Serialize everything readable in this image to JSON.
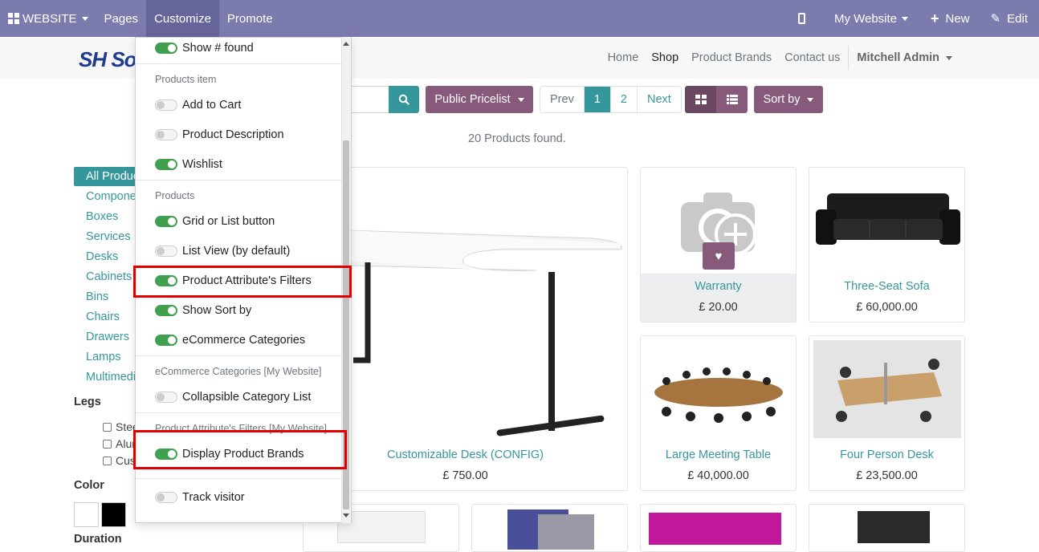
{
  "topbar": {
    "brand": "WEBSITE",
    "menu": [
      "Pages",
      "Customize",
      "Promote"
    ],
    "website_switcher": "My Website",
    "new_label": "New",
    "edit_label": "Edit",
    "bg_color": "#7c7bad"
  },
  "site": {
    "logo_text": "SH So",
    "nav": [
      "Home",
      "Shop",
      "Product Brands",
      "Contact us"
    ],
    "user": "Mitchell Admin"
  },
  "toolbar": {
    "pricelist": "Public Pricelist",
    "pager": [
      "Prev",
      "1",
      "2",
      "Next"
    ],
    "sort_label": "Sort by",
    "found_text": "20 Products found."
  },
  "sidebar": {
    "categories_active": "All Products",
    "categories": [
      "Components",
      "Boxes",
      "Services",
      "Desks",
      "Cabinets",
      "Bins",
      "Chairs",
      "Drawers",
      "Lamps",
      "Multimedia"
    ],
    "legs_heading": "Legs",
    "legs_options": [
      "Steel",
      "Aluminium",
      "Custom"
    ],
    "color_heading": "Color",
    "next_heading": "Duration"
  },
  "products": [
    {
      "name": "Customizable Desk (CONFIG)",
      "price": "£ 750.00"
    },
    {
      "name": "Warranty",
      "price": "£ 20.00"
    },
    {
      "name": "Three-Seat Sofa",
      "price": "£ 60,000.00"
    },
    {
      "name": "Large Meeting Table",
      "price": "£ 40,000.00"
    },
    {
      "name": "Four Person Desk",
      "price": "£ 23,500.00"
    }
  ],
  "customize": {
    "items": [
      {
        "label": "Show # found",
        "on": true
      },
      {
        "heading": "Products item"
      },
      {
        "label": "Add to Cart",
        "on": false
      },
      {
        "label": "Product Description",
        "on": false
      },
      {
        "label": "Wishlist",
        "on": true
      },
      {
        "heading": "Products"
      },
      {
        "label": "Grid or List button",
        "on": true
      },
      {
        "label": "List View (by default)",
        "on": false
      },
      {
        "label": "Product Attribute's Filters",
        "on": true
      },
      {
        "label": "Show Sort by",
        "on": true
      },
      {
        "label": "eCommerce Categories",
        "on": true
      },
      {
        "heading": "eCommerce Categories [My Website]"
      },
      {
        "label": "Collapsible Category List",
        "on": false
      },
      {
        "heading": "Product Attribute's Filters [My Website]"
      },
      {
        "label": "Display Product Brands",
        "on": true
      },
      {
        "label": "Track visitor",
        "on": false
      }
    ],
    "toggle_on_color": "#3fa04f",
    "highlight_color": "#e10000"
  }
}
